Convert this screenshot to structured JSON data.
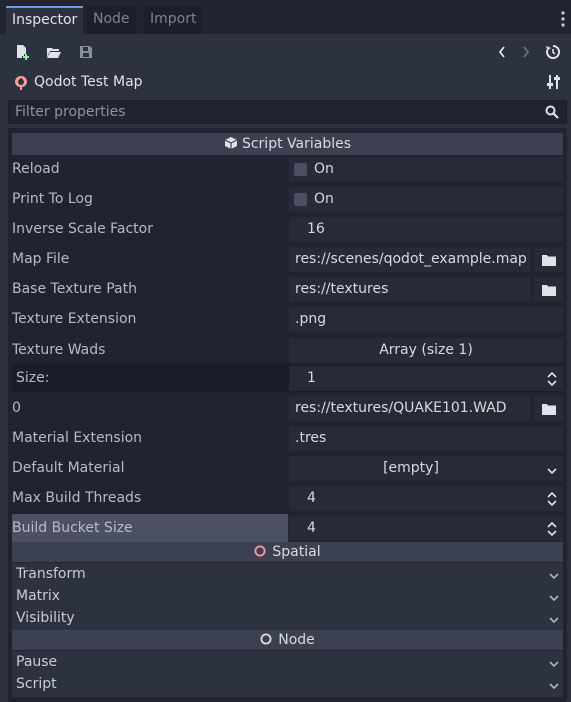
{
  "tabs": [
    {
      "label": "Inspector",
      "active": true
    },
    {
      "label": "Node",
      "active": false
    },
    {
      "label": "Import",
      "active": false
    }
  ],
  "toolbar": {
    "icons": [
      "new-script-icon",
      "open-folder-icon",
      "save-icon",
      "back-icon",
      "forward-icon",
      "history-icon"
    ]
  },
  "object": {
    "name": "Qodot Test Map",
    "icon": "qodot-icon",
    "settings_icon": "sliders-icon"
  },
  "filter": {
    "placeholder": "Filter properties",
    "value": ""
  },
  "sections": {
    "script_variables": "Script Variables",
    "spatial": "Spatial",
    "node": "Node"
  },
  "properties": {
    "reload": {
      "label": "Reload",
      "value": "On"
    },
    "print_to_log": {
      "label": "Print To Log",
      "value": "On"
    },
    "inverse_scale_factor": {
      "label": "Inverse Scale Factor",
      "value": "16"
    },
    "map_file": {
      "label": "Map File",
      "value": "res://scenes/qodot_example.map"
    },
    "base_texture_path": {
      "label": "Base Texture Path",
      "value": "res://textures"
    },
    "texture_extension": {
      "label": "Texture Extension",
      "value": ".png"
    },
    "texture_wads": {
      "label": "Texture Wads",
      "value": "Array (size 1)"
    },
    "wads_size": {
      "label": "Size:",
      "value": "1"
    },
    "wads_item0": {
      "label": "0",
      "value": "res://textures/QUAKE101.WAD"
    },
    "material_extension": {
      "label": "Material Extension",
      "value": ".tres"
    },
    "default_material": {
      "label": "Default Material",
      "value": "[empty]"
    },
    "max_build_threads": {
      "label": "Max Build Threads",
      "value": "4"
    },
    "build_bucket_size": {
      "label": "Build Bucket Size",
      "value": "4"
    }
  },
  "spatial_groups": [
    "Transform",
    "Matrix",
    "Visibility"
  ],
  "node_groups": [
    "Pause",
    "Script"
  ],
  "colors": {
    "accent": "#6b9ce8",
    "link": "#6ea3e6",
    "spatial_icon": "#fc9c9c",
    "panel": "#2c3240",
    "field": "#262b37"
  }
}
